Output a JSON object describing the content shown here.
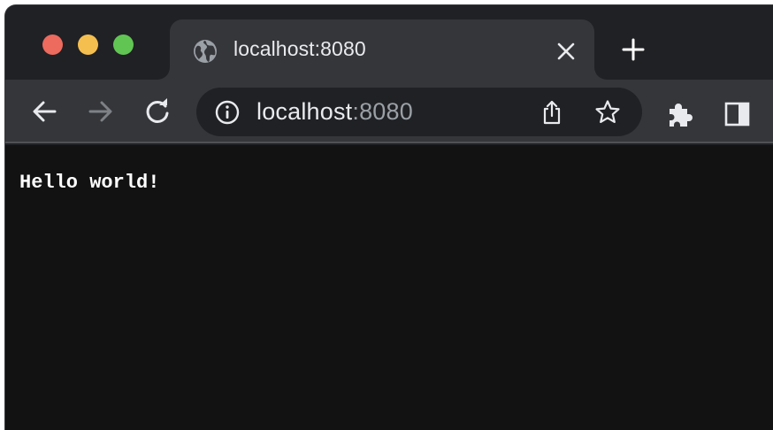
{
  "window": {
    "traffic_lights": {
      "close_color": "#ed6a5e",
      "minimize_color": "#f5bf4f",
      "maximize_color": "#61c554"
    }
  },
  "tab": {
    "title": "localhost:8080",
    "favicon": "globe-icon",
    "close_icon": "close-icon"
  },
  "new_tab": {
    "icon": "plus-icon"
  },
  "toolbar": {
    "back_icon": "arrow-left-icon",
    "forward_icon": "arrow-right-icon",
    "forward_enabled": false,
    "reload_icon": "reload-icon",
    "extensions_icon": "puzzle-icon",
    "side_panel_icon": "side-panel-icon"
  },
  "omnibox": {
    "info_icon": "info-icon",
    "host": "localhost",
    "port": ":8080",
    "share_icon": "share-icon",
    "bookmark_icon": "star-icon"
  },
  "page": {
    "body_text": "Hello world!"
  },
  "colors": {
    "frame": "#202124",
    "toolbar": "#35363a",
    "omnibox": "#202124",
    "page_background": "#121212",
    "text_primary": "#e8eaed",
    "text_secondary": "#9aa0a6"
  }
}
